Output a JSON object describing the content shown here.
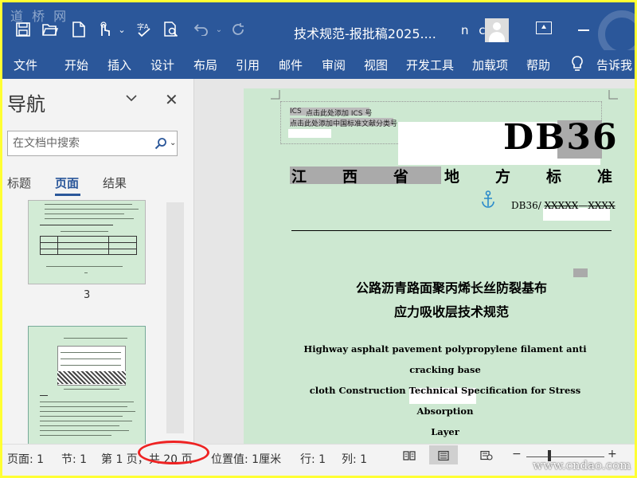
{
  "watermark_top": "道 桥 网",
  "watermark_bottom": "www.cndao.com",
  "window": {
    "title": "技术规范-报批稿2025....",
    "user": "n c"
  },
  "quick_access": [
    "save-icon",
    "open-icon",
    "new-document-icon",
    "touch-mode-icon",
    "spelling-icon",
    "print-preview-icon",
    "undo-icon",
    "redo-icon"
  ],
  "ribbon": {
    "tabs": [
      "文件",
      "开始",
      "插入",
      "设计",
      "布局",
      "引用",
      "邮件",
      "审阅",
      "视图",
      "开发工具",
      "加载项",
      "帮助",
      "告诉我"
    ]
  },
  "nav": {
    "title": "导航",
    "search_placeholder": "在文档中搜索",
    "tabs": [
      "标题",
      "页面",
      "结果"
    ],
    "active_tab": "页面",
    "thumb_page_label": "3"
  },
  "document": {
    "ics_label": "ICS",
    "ics_placeholder": "点击此处添加 ICS 号",
    "class_placeholder": "点击此处添加中国标准文献分类号",
    "std_code": "DB36",
    "province_standard": [
      "江",
      "西",
      "省",
      "地",
      "方",
      "标",
      "准"
    ],
    "std_number_prefix": "DB36/",
    "std_number_a": "XXXXX",
    "std_number_sep": "—",
    "std_number_b": "XXXX",
    "title_zh_line1": "公路沥青路面聚丙烯长丝防裂基布",
    "title_zh_line2": "应力吸收层技术规范",
    "title_en_line1": "Highway asphalt pavement polypropylene filament anti cracking base",
    "title_en_line2": "cloth Construction Technical Specification for Stress Absorption",
    "title_en_line3": "Layer"
  },
  "status": {
    "page": "页面: 1",
    "section": "节: 1",
    "page_of": "第 1 页，共 20 页",
    "position": "位置值: 1厘米",
    "line": "行: 1",
    "column": "列: 1",
    "zoom_minus": "−",
    "zoom_plus": "+",
    "zoom_level": 0.3
  },
  "colors": {
    "ribbon": "#2b579a",
    "page": "#cde8d1",
    "highlight_circle": "#ee2222"
  }
}
